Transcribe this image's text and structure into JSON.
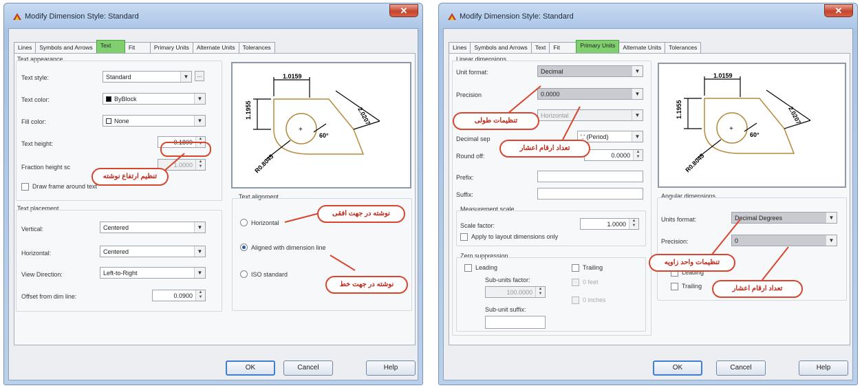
{
  "left": {
    "title": "Modify Dimension Style: Standard",
    "close": "✕",
    "tabs": [
      "Lines",
      "Symbols and Arrows",
      "Text",
      "Fit",
      "Primary Units",
      "Alternate Units",
      "Tolerances"
    ],
    "active_tab": "Text",
    "text_appearance": {
      "caption": "Text appearance",
      "text_style_label": "Text style:",
      "text_style_value": "Standard",
      "browse": "...",
      "text_color_label": "Text color:",
      "text_color_value": "ByBlock",
      "fill_color_label": "Fill color:",
      "fill_color_value": "None",
      "text_height_label": "Text height:",
      "text_height_value": "0.1800",
      "fraction_height_label": "Fraction height sc",
      "fraction_height_value": "1.0000",
      "draw_frame_label": "Draw frame around text"
    },
    "text_placement": {
      "caption": "Text placement",
      "vertical_label": "Vertical:",
      "vertical_value": "Centered",
      "horizontal_label": "Horizontal:",
      "horizontal_value": "Centered",
      "view_direction_label": "View Direction:",
      "view_direction_value": "Left-to-Right",
      "offset_label": "Offset from dim line:",
      "offset_value": "0.0900"
    },
    "text_alignment": {
      "caption": "Text alignment",
      "options": [
        "Horizontal",
        "Aligned with dimension line",
        "ISO standard"
      ],
      "selected": "Aligned with dimension line"
    },
    "preview": {
      "dim_top": "1.0159",
      "dim_left": "1.1955",
      "dim_right": "2.0207",
      "dim_angle": "60°",
      "dim_radius": "R0.8045"
    },
    "callouts": {
      "text_height": "تنظیم ارتفاع نوشته",
      "horizontal": "نوشته در جهت افقی",
      "aligned": "نوشته در جهت خط"
    },
    "buttons": {
      "ok": "OK",
      "cancel": "Cancel",
      "help": "Help"
    }
  },
  "right": {
    "title": "Modify Dimension Style: Standard",
    "close": "✕",
    "tabs": [
      "Lines",
      "Symbols and Arrows",
      "Text",
      "Fit",
      "Primary Units",
      "Alternate Units",
      "Tolerances"
    ],
    "active_tab": "Primary Units",
    "linear": {
      "caption": "Linear dimensions",
      "unit_format_label": "Unit format:",
      "unit_format_value": "Decimal",
      "precision_label": "Precision",
      "precision_value": "0.0000",
      "fraction_format_value": "Horizontal",
      "decimal_sep_label": "Decimal sep",
      "decimal_sep_value": "'.' (Period)",
      "round_off_label": "Round off:",
      "round_off_value": "0.0000",
      "prefix_label": "Prefix:",
      "suffix_label": "Suffix:"
    },
    "measurement": {
      "caption": "Measurement scale",
      "scale_factor_label": "Scale factor:",
      "scale_factor_value": "1.0000",
      "apply_layout_label": "Apply to layout dimensions only"
    },
    "zero_suppression": {
      "caption": "Zero suppression",
      "leading": "Leading",
      "trailing": "Trailing",
      "sub_units_factor_label": "Sub-units factor:",
      "sub_units_factor_value": "100.0000",
      "sub_unit_suffix_label": "Sub-unit suffix:",
      "feet": "0 feet",
      "inches": "0 inches"
    },
    "angular": {
      "caption": "Angular dimensions",
      "units_format_label": "Units format:",
      "units_format_value": "Decimal Degrees",
      "precision_label": "Precision:",
      "precision_value": "0",
      "zero_leading": "Leading",
      "zero_trailing": "Trailing"
    },
    "preview": {
      "dim_top": "1.0159",
      "dim_left": "1.1955",
      "dim_right": "2.0207",
      "dim_angle": "60°",
      "dim_radius": "R0.8045"
    },
    "callouts": {
      "length_settings": "تنظیمات طولی",
      "decimal_count": "تعداد ارقام اعشار",
      "angle_settings": "تنظیمات واحد زاویه",
      "angle_decimals": "تعداد ارقام اعشار"
    },
    "buttons": {
      "ok": "OK",
      "cancel": "Cancel",
      "help": "Help"
    }
  },
  "colors": {
    "callout_border": "#d7452e",
    "callout_text": "#c0281a",
    "active_tab": "#7fcf6e",
    "drawing": "#b58a3c"
  }
}
